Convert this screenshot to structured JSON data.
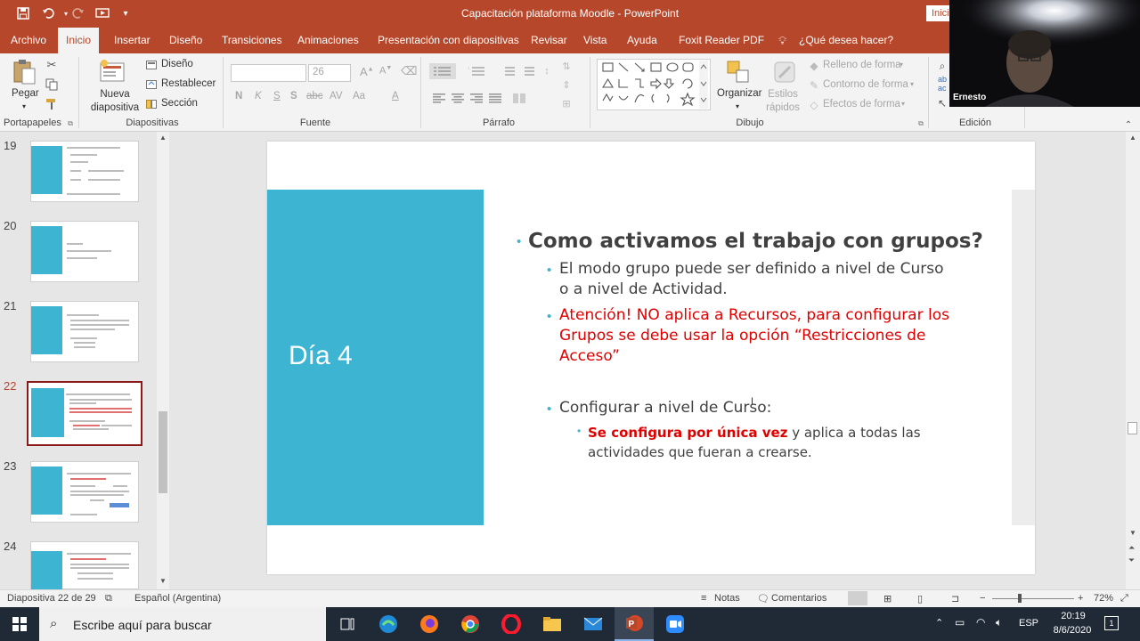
{
  "window": {
    "title": "Capacitación plataforma Moodle  -  PowerPoint",
    "signin_label": "Iniciar sesión"
  },
  "qat": {
    "save_icon": "save-icon",
    "undo_icon": "undo-icon",
    "redo_icon": "redo-icon",
    "present_icon": "present-from-start-icon",
    "customize_icon": "customize-qat-icon"
  },
  "tabs": [
    {
      "label": "Archivo"
    },
    {
      "label": "Inicio",
      "active": true
    },
    {
      "label": "Insertar"
    },
    {
      "label": "Diseño"
    },
    {
      "label": "Transiciones"
    },
    {
      "label": "Animaciones"
    },
    {
      "label": "Presentación con diapositivas"
    },
    {
      "label": "Revisar"
    },
    {
      "label": "Vista"
    },
    {
      "label": "Ayuda"
    },
    {
      "label": "Foxit Reader PDF"
    },
    {
      "label": "¿Qué desea hacer?"
    }
  ],
  "ribbon": {
    "clipboard": {
      "label": "Portapapeles",
      "paste": "Pegar"
    },
    "slides": {
      "label": "Diapositivas",
      "new_slide": "Nueva diapositiva",
      "layout": "Diseño",
      "reset": "Restablecer",
      "section": "Sección"
    },
    "font": {
      "label": "Fuente",
      "size": "26",
      "bold": "N",
      "italic": "K",
      "underline": "S",
      "strike": "S",
      "spacing": "abc",
      "case": "Aa"
    },
    "paragraph": {
      "label": "Párrafo"
    },
    "drawing": {
      "label": "Dibujo",
      "arrange": "Organizar",
      "quick_styles": "Estilos rápidos",
      "fill": "Relleno de forma",
      "outline": "Contorno de forma",
      "effects": "Efectos de forma"
    },
    "editing": {
      "label": "Edición",
      "select": "Seleccionar"
    }
  },
  "thumbnails": [
    {
      "num": "19"
    },
    {
      "num": "20"
    },
    {
      "num": "21"
    },
    {
      "num": "22",
      "current": true
    },
    {
      "num": "23"
    },
    {
      "num": "24"
    }
  ],
  "slide": {
    "title": "Día 4",
    "heading": "Como activamos el trabajo con grupos?",
    "bullet1_line1": "El modo grupo puede ser definido a nivel de Curso",
    "bullet1_line2": "o a nivel de Actividad.",
    "bullet2_line1": "Atención! NO aplica a Recursos, para configurar los",
    "bullet2_line2": "Grupos se debe usar la opción “Restricciones de",
    "bullet2_line3": "Acceso”",
    "bullet3": "Configurar a nivel de Curso:",
    "sub_red": "Se configura por única vez",
    "sub_rest_line1": " y aplica a todas las",
    "sub_rest_line2": "actividades que fueran a crearse."
  },
  "status": {
    "slide_info": "Diapositiva 22 de 29",
    "language": "Español (Argentina)",
    "notes": "Notas",
    "comments": "Comentarios",
    "zoom": "72%"
  },
  "taskbar": {
    "search_placeholder": "Escribe aquí para buscar",
    "lang": "ESP",
    "time": "20:19",
    "date": "8/6/2020",
    "notification_count": "1"
  },
  "webcam": {
    "name": "Ernesto"
  },
  "colors": {
    "accent": "#b7472a",
    "slide_cyan": "#3db5d2",
    "red_text": "#e00000"
  }
}
